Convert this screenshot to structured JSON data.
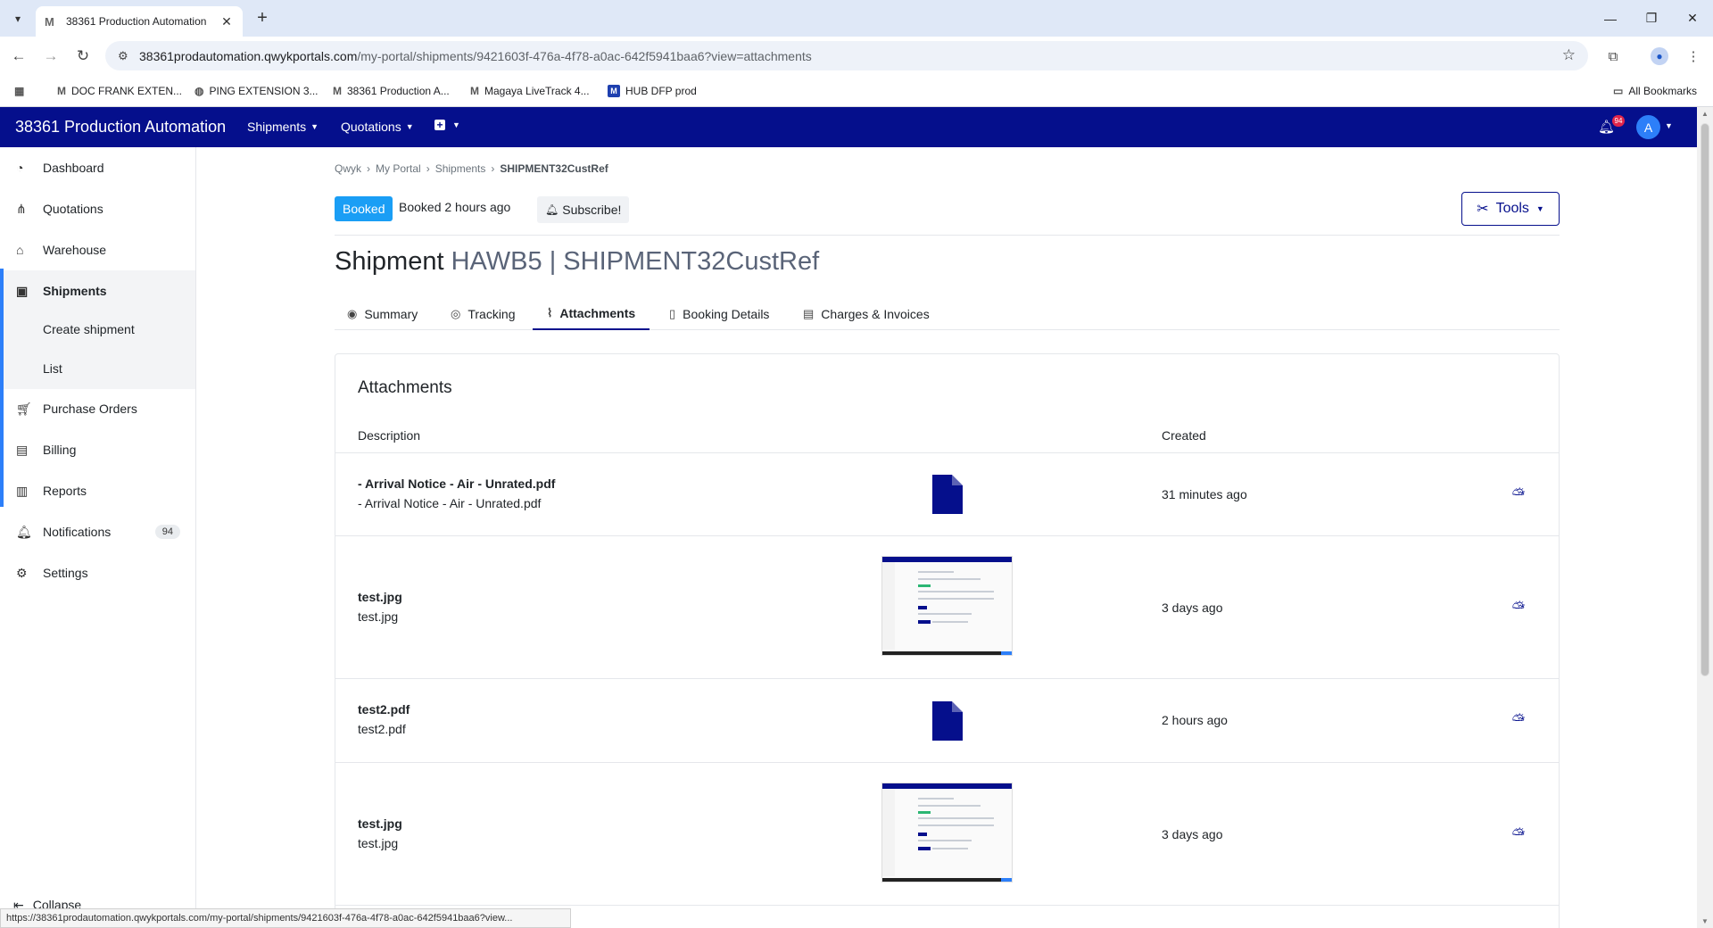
{
  "browser": {
    "tab_title": "38361 Production Automation",
    "tab_favicon": "M",
    "url_domain": "38361prodautomation.qwykportals.com",
    "url_path": "/my-portal/shipments/9421603f-476a-4f78-a0ac-642f5941baa6?view=attachments",
    "bookmarks": [
      {
        "icon": "M",
        "label": "DOC FRANK EXTEN..."
      },
      {
        "icon": "globe",
        "label": "PING EXTENSION 3..."
      },
      {
        "icon": "M",
        "label": "38361 Production A..."
      },
      {
        "icon": "M",
        "label": "Magaya LiveTrack 4..."
      },
      {
        "icon": "M",
        "label": "HUB DFP prod"
      }
    ],
    "all_bookmarks": "All Bookmarks",
    "status_url": "https://38361prodautomation.qwykportals.com/my-portal/shipments/9421603f-476a-4f78-a0ac-642f5941baa6?view..."
  },
  "appbar": {
    "brand": "38361 Production Automation",
    "nav": [
      "Shipments",
      "Quotations"
    ],
    "notification_count": "94",
    "avatar_initial": "A",
    "brand_color": "#050f8c"
  },
  "sidebar": {
    "items": [
      {
        "label": "Dashboard",
        "icon": "dashboard-icon"
      },
      {
        "label": "Quotations",
        "icon": "quotations-icon"
      },
      {
        "label": "Warehouse",
        "icon": "warehouse-icon"
      },
      {
        "label": "Shipments",
        "icon": "shipments-icon"
      },
      {
        "label": "Purchase Orders",
        "icon": "cart-icon"
      },
      {
        "label": "Billing",
        "icon": "billing-icon"
      },
      {
        "label": "Reports",
        "icon": "reports-icon"
      },
      {
        "label": "Notifications",
        "icon": "bell-icon",
        "badge": "94"
      },
      {
        "label": "Settings",
        "icon": "gear-icon"
      }
    ],
    "shipments_sub": [
      "Create shipment",
      "List"
    ],
    "collapse": "Collapse"
  },
  "breadcrumb": [
    "Qwyk",
    "My Portal",
    "Shipments",
    "SHIPMENT32CustRef"
  ],
  "shipment": {
    "status": "Booked",
    "booked_ago": "Booked 2 hours ago",
    "subscribe": "Subscribe!",
    "tools": "Tools",
    "heading_prefix": "Shipment",
    "heading_ids": "HAWB5 | SHIPMENT32CustRef"
  },
  "tabs": [
    {
      "label": "Summary",
      "icon": "rss-icon"
    },
    {
      "label": "Tracking",
      "icon": "tracking-icon"
    },
    {
      "label": "Attachments",
      "icon": "paperclip-icon"
    },
    {
      "label": "Booking Details",
      "icon": "document-icon"
    },
    {
      "label": "Charges & Invoices",
      "icon": "invoice-icon"
    }
  ],
  "attachments": {
    "title": "Attachments",
    "col_description": "Description",
    "col_created": "Created",
    "rows": [
      {
        "name": "- Arrival Notice - Air - Unrated.pdf",
        "sub": "- Arrival Notice - Air - Unrated.pdf",
        "created": "31 minutes ago",
        "preview": "pdf"
      },
      {
        "name": "test.jpg",
        "sub": "test.jpg",
        "created": "3 days ago",
        "preview": "image"
      },
      {
        "name": "test2.pdf",
        "sub": "test2.pdf",
        "created": "2 hours ago",
        "preview": "pdf"
      },
      {
        "name": "test.jpg",
        "sub": "test.jpg",
        "created": "3 days ago",
        "preview": "image"
      }
    ]
  }
}
